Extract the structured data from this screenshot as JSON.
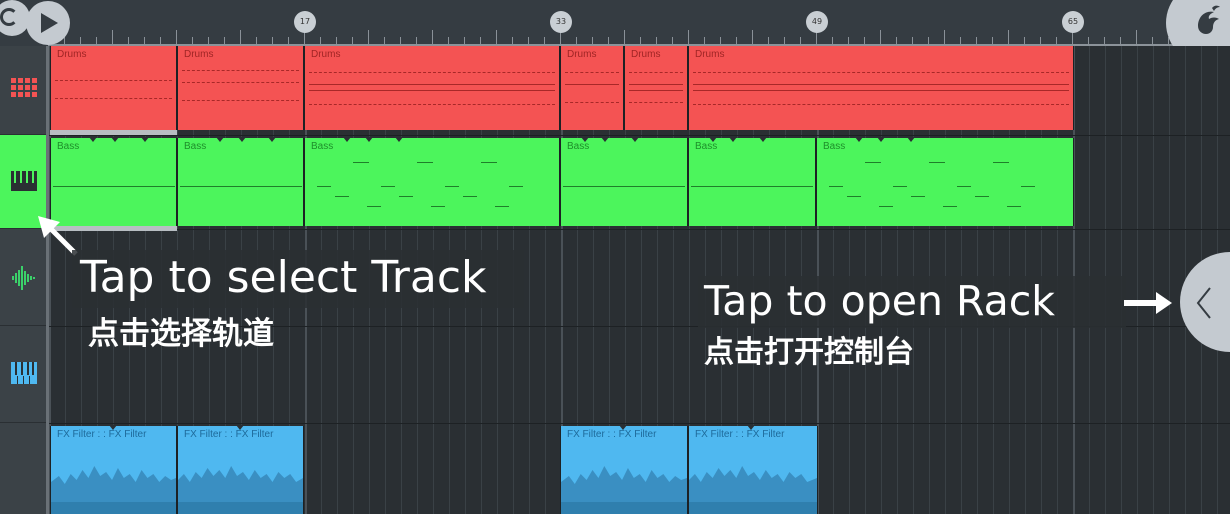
{
  "toolbar": {
    "loop_icon": "loop-icon",
    "play_icon": "play-icon",
    "logo_icon": "fl-studio-logo-icon"
  },
  "timeline": {
    "markers": [
      "17",
      "33",
      "49",
      "65"
    ]
  },
  "tracks": [
    {
      "id": "drums",
      "icon": "drum-pads-icon",
      "color": "#f45353",
      "selected": false
    },
    {
      "id": "bass",
      "icon": "piano-keys-icon",
      "color": "#4cf55c",
      "selected": true
    },
    {
      "id": "audio",
      "icon": "waveform-icon",
      "color": "#3bd16a",
      "selected": false
    },
    {
      "id": "keys",
      "icon": "piano-keys-icon",
      "color": "#4fb8f0",
      "selected": false
    },
    {
      "id": "fx",
      "icon": "",
      "color": "#4fb8f0",
      "selected": false
    }
  ],
  "clips": {
    "drums": [
      "Drums",
      "Drums",
      "Drums",
      "Drums",
      "Drums",
      "Drums"
    ],
    "bass": [
      "Bass",
      "Bass",
      "Bass",
      "Bass",
      "Bass",
      "Bass"
    ],
    "fx": [
      "FX Filter : : FX Filter",
      "FX Filter : : FX Filter",
      "FX Filter : : FX Filter",
      "FX Filter : : FX Filter"
    ]
  },
  "hints": {
    "select_track_en": "Tap to select Track",
    "select_track_zh": "点击选择轨道",
    "open_rack_en": "Tap to open Rack",
    "open_rack_zh": "点击打开控制台",
    "arrow_icon": "arrow-right-icon",
    "rack_icon": "chevron-left-icon"
  }
}
